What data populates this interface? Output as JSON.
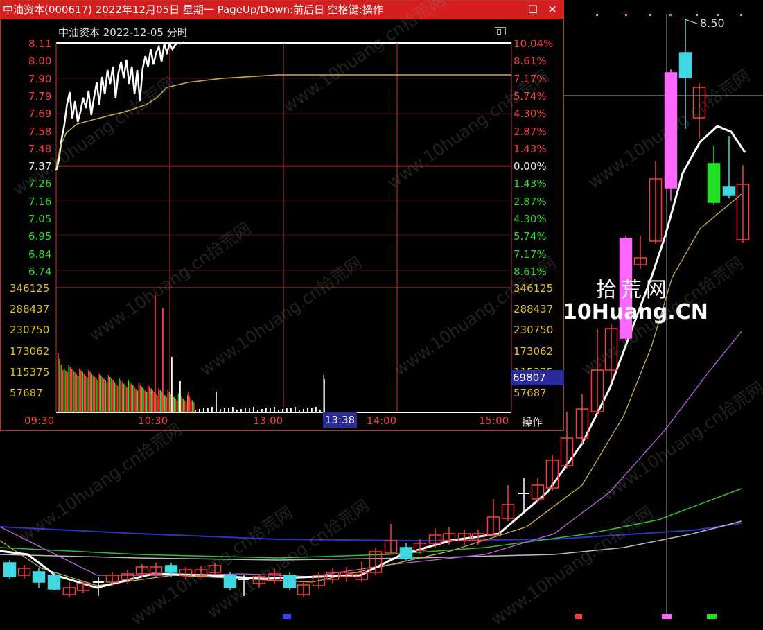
{
  "window": {
    "title": "中油资本(000617) 2022年12月05日 星期一 PageUp/Down:前后日 空格键:操作",
    "restore_glyph": "☐",
    "close_glyph": "✕"
  },
  "intraday": {
    "header": "中油资本  2022-12-05 分时",
    "price_axis": [
      "8.11",
      "8.00",
      "7.90",
      "7.79",
      "7.69",
      "7.58",
      "7.48",
      "7.37",
      "7.26",
      "7.16",
      "7.05",
      "6.95",
      "6.84",
      "6.74"
    ],
    "pct_axis": [
      "10.04%",
      "8.61%",
      "7.17%",
      "5.74%",
      "4.30%",
      "2.87%",
      "1.43%",
      "0.00%",
      "1.43%",
      "2.87%",
      "4.30%",
      "5.74%",
      "7.17%",
      "8.61%"
    ],
    "volume_axis": [
      "346125",
      "288437",
      "230750",
      "173062",
      "115375",
      "57687"
    ],
    "time_axis": [
      "09:30",
      "10:30",
      "13:00",
      "14:00",
      "15:00"
    ],
    "cursor_time": "13:38",
    "cursor_volume": "69807",
    "operate_label": "操作",
    "colors": {
      "up": "#ff3b3b",
      "down": "#22e022",
      "price_line": "#ffffff",
      "avg_line": "#c8b040"
    }
  },
  "kline": {
    "peak_price": "8.50",
    "colors": {
      "up": "#ff3b3b",
      "down": "#40d8e0",
      "limit_up": "#ff66ff",
      "green_down": "#22e022",
      "ma5": "#ffffff",
      "ma10": "#c8b040",
      "ma20": "#c060e0",
      "ma60": "#30c030",
      "ma120": "#3030c0",
      "ma250": "#bbbbbb"
    }
  },
  "logo": {
    "cn": "拾荒网",
    "en": "10Huang.CN"
  },
  "watermark": "www.10huang.cn拾荒网"
}
